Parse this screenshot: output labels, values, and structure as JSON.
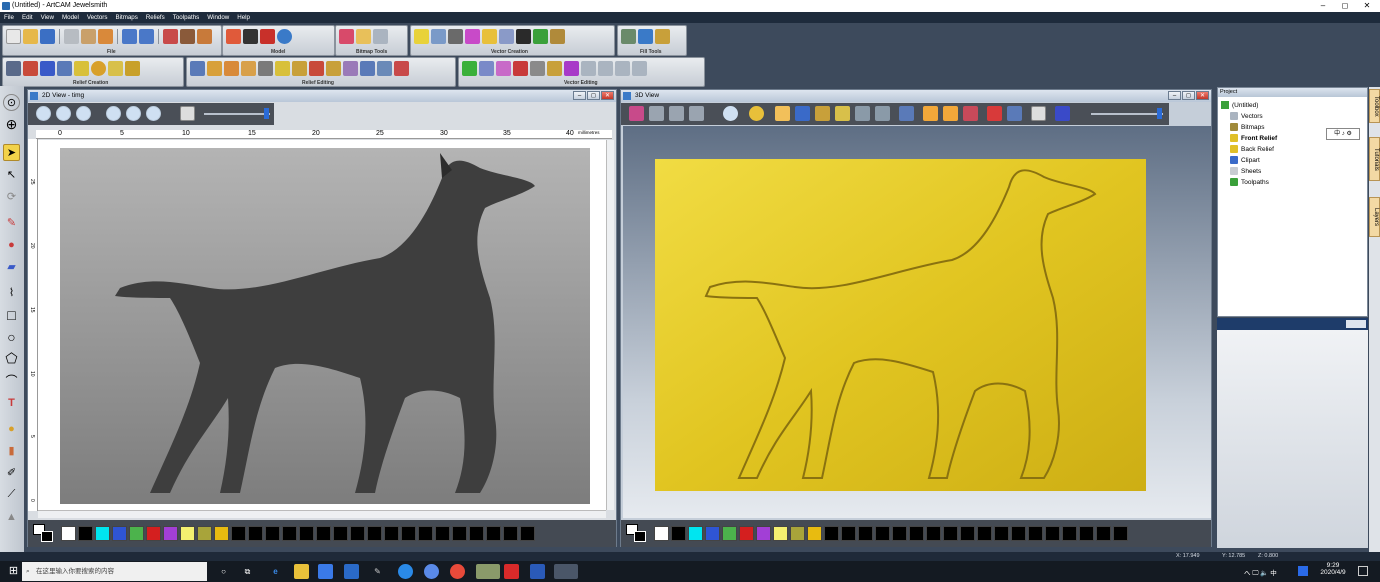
{
  "window": {
    "title": "(Untitled) - ArtCAM Jewelsmith",
    "minimize": "–",
    "maximize": "◻",
    "close": "✕"
  },
  "menu": [
    "File",
    "Edit",
    "View",
    "Model",
    "Vectors",
    "Bitmaps",
    "Reliefs",
    "Toolpaths",
    "Window",
    "Help"
  ],
  "toolbar_groups": [
    "File",
    "Model",
    "Bitmap Tools",
    "Vector Creation",
    "Fill Tools",
    "Relief Creation",
    "Relief Editing",
    "Vector Editing"
  ],
  "view2d": {
    "title": "2D View - timg",
    "ruler_ticks": [
      "0",
      "5",
      "10",
      "15",
      "20",
      "25",
      "30",
      "35",
      "40"
    ],
    "ruler_unit": "millimetres",
    "vruler_ticks": [
      "25",
      "20",
      "15",
      "10",
      "5",
      "0"
    ]
  },
  "view3d": {
    "title": "3D View"
  },
  "colors": {
    "accent": "#1e2b3c",
    "relief_gold": "#e6cc2e",
    "palette": [
      "#ffffff",
      "#000000",
      "#00e5f0",
      "#2f55d4",
      "#4cb34c",
      "#d41f1f",
      "#a23fd6",
      "#f4f070",
      "#a8a43a",
      "#e8bb10",
      "#000000",
      "#000000",
      "#000000",
      "#000000",
      "#000000",
      "#000000",
      "#000000",
      "#000000",
      "#000000",
      "#000000",
      "#000000",
      "#000000",
      "#000000",
      "#000000",
      "#000000",
      "#000000",
      "#000000",
      "#000000"
    ]
  },
  "project": {
    "header": "Project",
    "items": [
      "(Untitled)",
      "Vectors",
      "Bitmaps",
      "Front Relief",
      "Back Relief",
      "Clipart",
      "Sheets",
      "Toolpaths"
    ]
  },
  "side_tabs": [
    "Toolbox",
    "Tutorials",
    "Layers"
  ],
  "ime": "中 ♪ ⚙",
  "status": {
    "x": "X: 17.949",
    "y": "Y: 12.785",
    "z": "Z: 0.800"
  },
  "taskbar": {
    "search_placeholder": "在这里输入你要搜索的内容",
    "time": "9:29",
    "date": "2020/4/9",
    "tray": "へ 🖵 🔈 中"
  }
}
